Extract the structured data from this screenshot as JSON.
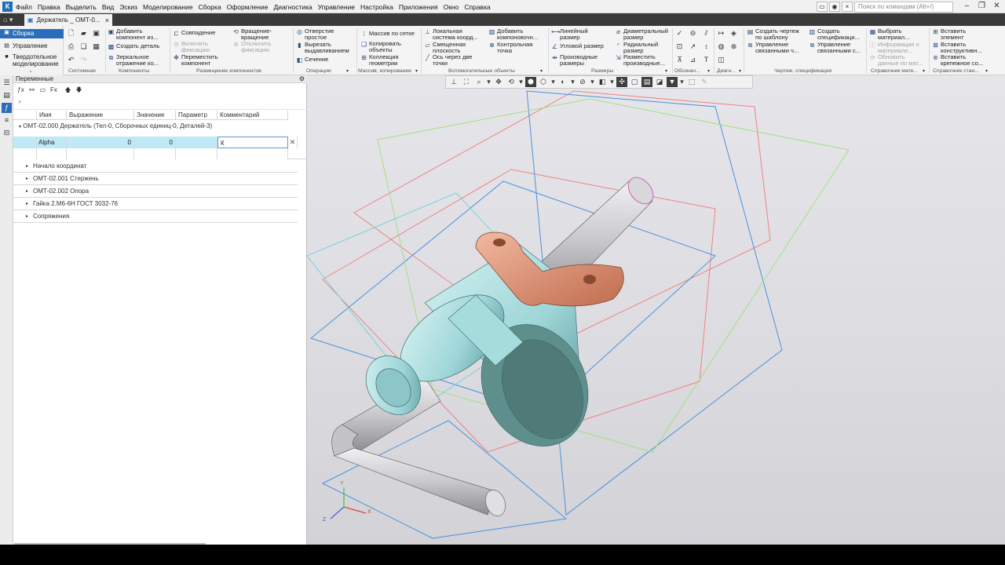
{
  "menu": {
    "logo_icon": "kompas-logo-icon",
    "items": [
      "Файл",
      "Правка",
      "Выделить",
      "Вид",
      "Эскиз",
      "Моделирование",
      "Сборка",
      "Оформление",
      "Диагностика",
      "Управление",
      "Настройка",
      "Приложения",
      "Окно",
      "Справка"
    ],
    "search_placeholder": "Поиск по командам (Alt+/)"
  },
  "tabs": {
    "document_title": "Держатель _ ОМТ-0...",
    "close": "×"
  },
  "modes": {
    "assembly": "Сборка",
    "management": "Управление",
    "solid_modeling_line1": "Твердотельное",
    "solid_modeling_line2": "моделирование"
  },
  "ribbon": {
    "system_group": "Системная",
    "components_group": "Компоненты",
    "placement_group": "Размещение компонентов",
    "operations_group": "Операции",
    "arrays_group": "Массив, копирование",
    "aux_group": "Вспомогательные объекты",
    "dimensions_group": "Размеры",
    "notation_group": "Обознач...",
    "diag_group": "Диагн...",
    "drawing_group": "Чертеж, спецификация",
    "materials_group": "Справочник мате...",
    "standard_group": "Справочник стан...",
    "add_component_l1": "Добавить",
    "add_component_l2": "компонент из...",
    "create_part": "Создать деталь",
    "mirror_l1": "Зеркальное",
    "mirror_l2": "отражение ко...",
    "coincidence": "Совпадение",
    "enable_fix_l1": "Включить",
    "enable_fix_l2": "фиксацию",
    "move_component_l1": "Переместить",
    "move_component_l2": "компонент",
    "rotate_l1": "Вращение-",
    "rotate_l2": "вращение",
    "disable_fix_l1": "Отключить",
    "disable_fix_l2": "фиксацию",
    "hole_l1": "Отверстие",
    "hole_l2": "простое",
    "cut_extrude_l1": "Вырезать",
    "cut_extrude_l2": "выдавливанием",
    "section": "Сечение",
    "grid_array": "Массив по сетке",
    "copy_objects_l1": "Копировать",
    "copy_objects_l2": "объекты",
    "geometry_collection_l1": "Коллекция",
    "geometry_collection_l2": "геометрии",
    "local_cs_l1": "Локальная",
    "local_cs_l2": "система коорд...",
    "offset_plane_l1": "Смещенная",
    "offset_plane_l2": "плоскость",
    "axis_two_points_l1": "Ось через две",
    "axis_two_points_l2": "точки",
    "add_component_geom_l1": "Добавить",
    "add_component_geom_l2": "компоновочн...",
    "control_point_l1": "Контрольная",
    "control_point_l2": "точка",
    "linear_dim_l1": "Линейный",
    "linear_dim_l2": "размер",
    "angular_dim": "Угловой размер",
    "derived_dim_l1": "Производные",
    "derived_dim_l2": "размеры",
    "diameter_dim_l1": "Диаметральный",
    "diameter_dim_l2": "размер",
    "radial_dim_l1": "Радиальный",
    "radial_dim_l2": "размер",
    "show_derived_l1": "Разместить",
    "show_derived_l2": "производные...",
    "create_drawing_l1": "Создать чертеж",
    "create_drawing_l2": "по шаблону",
    "manage_linked_l1": "Управление",
    "manage_linked_l2": "связанными ч...",
    "create_spec_l1": "Создать",
    "create_spec_l2": "спецификаци...",
    "manage_linked_spec_l1": "Управление",
    "manage_linked_spec_l2": "связанными с...",
    "select_material_l1": "Выбрать",
    "select_material_l2": "материал...",
    "material_info_l1": "Информация о",
    "material_info_l2": "материале...",
    "update_data_l1": "Обновить",
    "update_data_l2": "данные по мат...",
    "insert_element_l1": "Вставить",
    "insert_element_l2": "элемент",
    "insert_structural_l1": "Вставить",
    "insert_structural_l2": "конструктивн...",
    "insert_fastener_l1": "Вставить",
    "insert_fastener_l2": "крепежное со..."
  },
  "panel": {
    "title": "Переменные",
    "columns": [
      "Имя",
      "Выражение",
      "Значение",
      "Параметр",
      "Комментарий"
    ],
    "assembly_row": "ОМТ-02.000 Держатель (Тел-0, Сборочных единиц-0, Деталей-3)",
    "variable": {
      "name": "Alpha",
      "expression": "0",
      "value": "0",
      "parameter": "",
      "comment": "К"
    },
    "tree": [
      "Начало координат",
      "ОМТ-02.001 Стержень",
      "ОМТ-02.002 Опора",
      "Гайка 2.М6-6Н ГОСТ 3032-76",
      "Сопряжения"
    ]
  },
  "viewport": {
    "axis_x": "X",
    "axis_y": "Y",
    "axis_z": "Z",
    "colors": {
      "rod": "#c9c9cc",
      "support": "#9fd6d8",
      "nut": "#d98a6a",
      "plane_red": "#f08080",
      "plane_blue": "#4a90e0",
      "plane_green": "#a0e080"
    }
  }
}
